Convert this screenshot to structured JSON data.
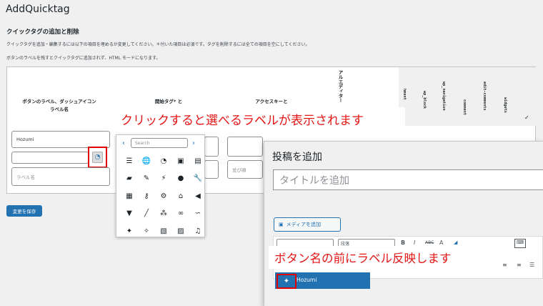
{
  "page": {
    "title": "AddQuicktag",
    "section_title": "クイックタグの追加と削除",
    "description_1": "クイックタグを追加・編集するには以下の項目を埋めるか変更してください。＊付いた項目は必須です。タグを削除するには全ての項目を空にしてください。",
    "description_2": "ボタンのラベルを残すとクイックタグに追加されず、HTML モードになります。"
  },
  "table": {
    "col_button_label": "ボタンのラベル、ダッシュアイコン",
    "col_button_label_2": "ラベル名",
    "col_start_tag": "開始タグ* と",
    "col_access_key": "アクセスキーと",
    "vertical_headers": [
      "アルエディター",
      "hment",
      "wp_block",
      "wp_navigation",
      "comment",
      "edit-comments",
      "widgets"
    ],
    "checkmark": "✓",
    "button_value": "Hozumi",
    "label_placeholder": "ラベル名",
    "order_placeholder": "並び順"
  },
  "save_button": "変更を保存",
  "picker": {
    "prev": "‹",
    "next": "›",
    "search_placeholder": "Search",
    "icons": [
      {
        "name": "menu-icon",
        "glyph": "☰"
      },
      {
        "name": "admin-site-icon",
        "glyph": "🌐"
      },
      {
        "name": "dashboard-icon",
        "glyph": "◔"
      },
      {
        "name": "admin-post-icon",
        "glyph": "▣"
      },
      {
        "name": "admin-page-icon",
        "glyph": "▤"
      },
      {
        "name": "comments-icon",
        "glyph": "▰"
      },
      {
        "name": "appearance-icon",
        "glyph": "✎"
      },
      {
        "name": "plugins-icon",
        "glyph": "⚡"
      },
      {
        "name": "users-icon",
        "glyph": "●"
      },
      {
        "name": "tools-icon",
        "glyph": "🔧"
      },
      {
        "name": "settings-icon",
        "glyph": "▦"
      },
      {
        "name": "key-icon",
        "glyph": "⚷"
      },
      {
        "name": "gear-icon",
        "glyph": "⚙"
      },
      {
        "name": "home-icon",
        "glyph": "⌂"
      },
      {
        "name": "back-icon",
        "glyph": "◀"
      },
      {
        "name": "filter-icon",
        "glyph": "▼"
      },
      {
        "name": "brush-icon",
        "glyph": "╱"
      },
      {
        "name": "network-icon",
        "glyph": "⁂"
      },
      {
        "name": "link-icon",
        "glyph": "∞"
      },
      {
        "name": "unlink-icon",
        "glyph": "∽"
      },
      {
        "name": "pin-icon",
        "glyph": "✦"
      },
      {
        "name": "pin-alt-icon",
        "glyph": "✧"
      },
      {
        "name": "image-icon",
        "glyph": "▧"
      },
      {
        "name": "archive-icon",
        "glyph": "▨"
      },
      {
        "name": "music-icon",
        "glyph": "♫"
      }
    ]
  },
  "annotations": {
    "banner_1": "クリックすると選べるラベルが表示されます",
    "banner_2": "ボタン名の前にラベル反映します"
  },
  "editor": {
    "title": "投稿を追加",
    "title_placeholder": "タイトルを追加",
    "media_button": "メディアを追加",
    "paragraph_select": "段落",
    "toolbar": [
      "B",
      "I",
      "ABC",
      "A"
    ],
    "dropdown_item": "Hozumi"
  },
  "colors": {
    "wp_blue": "#2271b1",
    "annotation_red": "#e31616",
    "highlight_border": "#e10000"
  }
}
